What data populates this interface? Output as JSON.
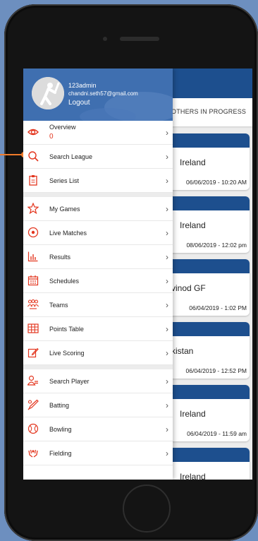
{
  "drawer": {
    "user_name": "123admin",
    "user_email": "chandni.seth57@gmail.com",
    "logout_label": "Logout",
    "items": [
      {
        "label": "Overview",
        "icon": "eye-icon",
        "count": "0"
      },
      {
        "label": "Search League",
        "icon": "search-icon"
      },
      {
        "label": "Series List",
        "icon": "clipboard-icon"
      },
      {
        "label": "My Games",
        "icon": "star-icon"
      },
      {
        "label": "Live Matches",
        "icon": "live-icon"
      },
      {
        "label": "Results",
        "icon": "bar-chart-icon"
      },
      {
        "label": "Schedules",
        "icon": "calendar-icon"
      },
      {
        "label": "Teams",
        "icon": "team-icon"
      },
      {
        "label": "Points Table",
        "icon": "grid-table-icon"
      },
      {
        "label": "Live Scoring",
        "icon": "edit-icon"
      },
      {
        "label": "Search Player",
        "icon": "player-icon"
      },
      {
        "label": "Batting",
        "icon": "bat-icon"
      },
      {
        "label": "Bowling",
        "icon": "ball-icon"
      },
      {
        "label": "Fielding",
        "icon": "hands-icon"
      }
    ],
    "chevron": "›"
  },
  "tabs": {
    "visible_label": "OTHERS IN PROGRESS"
  },
  "cards": [
    {
      "team": "Ireland",
      "date": "06/06/2019 - 10:20 AM"
    },
    {
      "team": "Ireland",
      "date": "08/06/2019 - 12:02 pm"
    },
    {
      "team": "vinod GF",
      "date": "06/04/2019 - 1:02 PM"
    },
    {
      "team": "kistan",
      "date": "06/04/2019 - 12:52 PM"
    },
    {
      "team": "Ireland",
      "date": "06/04/2019 - 11:59 am"
    },
    {
      "team": "Ireland",
      "date": ""
    }
  ],
  "colors": {
    "accent": "#e3361f",
    "header_blue": "#1d4f8e",
    "drawer_header": "#3f6fb0",
    "pointer": "#f07b2a"
  }
}
